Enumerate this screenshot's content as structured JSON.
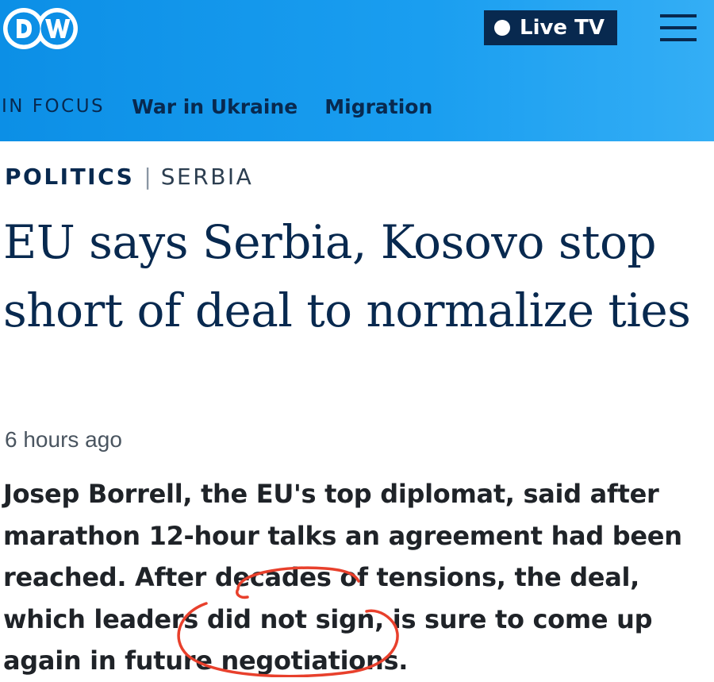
{
  "header": {
    "logo_text": "DW",
    "live_tv_label": "Live TV",
    "nav": {
      "in_focus_label": "IN FOCUS",
      "links": [
        "War in Ukraine",
        "Migration"
      ]
    }
  },
  "article": {
    "category": "POLITICS",
    "separator": "|",
    "subcategory": "SERBIA",
    "headline": "EU says Serbia, Kosovo stop short of deal to normalize ties",
    "timestamp": "6 hours ago",
    "lead": "Josep Borrell, the EU's top diplomat, said after marathon 12-hour talks an agreement had been reached. After decades of tensions, the deal, which leaders did not sign, is sure to come up again in future negotiations."
  },
  "colors": {
    "header_blue": "#1a9ef0",
    "navy": "#08294f",
    "annotation_red": "#e8402c"
  },
  "icons": [
    "dw-logo",
    "live-dot-icon",
    "hamburger-menu-icon"
  ]
}
